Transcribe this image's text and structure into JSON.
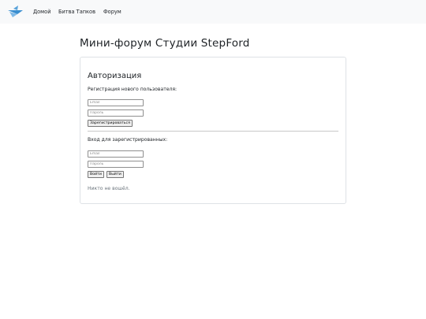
{
  "navbar": {
    "logo_icon": "bird-logo-icon",
    "links": [
      {
        "label": "Домой"
      },
      {
        "label": "Битва Тапков"
      },
      {
        "label": "Форум"
      }
    ]
  },
  "page_title": "Мини-форум Студии StepFord",
  "auth": {
    "title": "Авторизация",
    "register": {
      "label": "Регистрация нового пользователя:",
      "email_placeholder": "Email",
      "password_placeholder": "Пароль",
      "button": "Зарегистрироваться"
    },
    "login": {
      "label": "Вход для зарегистрированных:",
      "email_placeholder": "Email",
      "password_placeholder": "Пароль",
      "login_button": "Войти",
      "logout_button": "Выйти"
    },
    "status": "Никто не вошёл."
  },
  "colors": {
    "navbar_bg": "#f8f9fa",
    "card_border": "#dee2e6",
    "logo_blue": "#3a8fd0"
  }
}
